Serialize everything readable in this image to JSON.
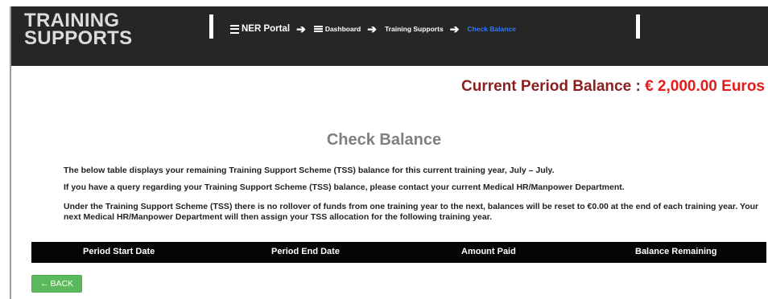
{
  "app": {
    "title_line1": "TRAINING",
    "title_line2": "SUPPORTS"
  },
  "breadcrumb": {
    "items": [
      {
        "label": "NER Portal",
        "icon": "menu-icon"
      },
      {
        "label": "Dashboard",
        "icon": "list-icon"
      },
      {
        "label": "Training Supports"
      },
      {
        "label": "Check Balance",
        "active": true
      }
    ],
    "separator": "➔"
  },
  "balance": {
    "label": "Current Period Balance : ",
    "amount": "€ 2,000.00 Euros"
  },
  "page_title": "Check Balance",
  "paragraphs": [
    "The below table displays your remaining Training Support Scheme (TSS) balance for this current training year, July – July.",
    "If you have a query regarding your Training Support Scheme (TSS) balance, please contact your current Medical HR/Manpower Department.",
    "Under the Training Support Scheme (TSS) there is no rollover of funds from one training year to the next, balances will be reset to €0.00 at the end of each training year. Your next Medical HR/Manpower Department will then assign your TSS allocation for the following training year."
  ],
  "table": {
    "columns": [
      "Period Start Date",
      "Period End Date",
      "Amount Paid",
      "Balance Remaining"
    ],
    "rows": []
  },
  "back_button": {
    "icon": "←",
    "label": "BACK"
  },
  "colors": {
    "header_bg": "#262626",
    "breadcrumb_active": "#2f79ff",
    "balance_label": "#8a1f1f",
    "balance_amount": "#e41b1b",
    "back_button": "#5cb85c"
  }
}
